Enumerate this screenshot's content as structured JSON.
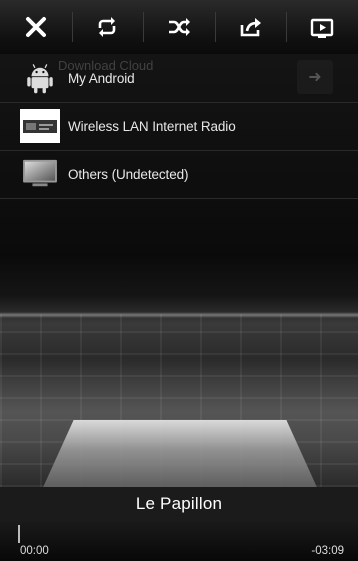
{
  "toolbar": {
    "buttons": [
      {
        "name": "close",
        "icon": "close-icon"
      },
      {
        "name": "repeat",
        "icon": "repeat-icon"
      },
      {
        "name": "shuffle",
        "icon": "shuffle-icon"
      },
      {
        "name": "share",
        "icon": "share-icon"
      },
      {
        "name": "video",
        "icon": "video-icon"
      }
    ]
  },
  "devices": {
    "background_text": "Download Cloud",
    "items": [
      {
        "label": "My Android",
        "icon": "android-icon"
      },
      {
        "label": "Wireless LAN Internet Radio",
        "icon": "radio-device-icon"
      },
      {
        "label": "Others (Undetected)",
        "icon": "monitor-icon"
      }
    ]
  },
  "player": {
    "track_title": "Le Papillon",
    "elapsed": "00:00",
    "remaining": "-03:09",
    "progress": 0.0
  },
  "colors": {
    "background": "#000000",
    "toolbar": "#1a1a1a",
    "text": "#ffffff"
  }
}
